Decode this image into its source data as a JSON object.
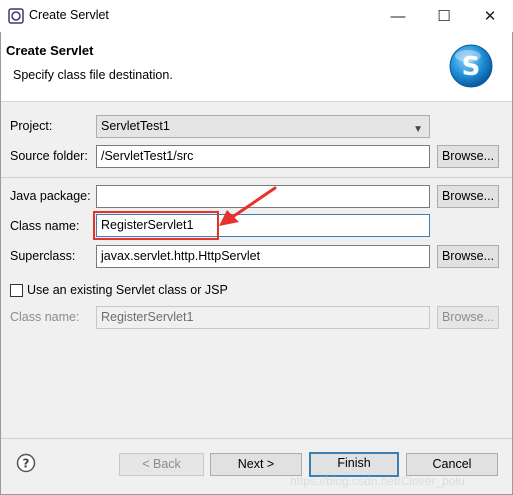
{
  "window": {
    "title": "Create Servlet",
    "controls": {
      "minimize": "—",
      "maximize": "☐",
      "close": "✕"
    }
  },
  "banner": {
    "title": "Create Servlet",
    "description": "Specify class file destination."
  },
  "form": {
    "project": {
      "label": "Project:",
      "value": "ServletTest1"
    },
    "source_folder": {
      "label": "Source folder:",
      "value": "/ServletTest1/src",
      "button": "Browse..."
    },
    "java_package": {
      "label": "Java package:",
      "value": "",
      "button": "Browse..."
    },
    "class_name": {
      "label": "Class name:",
      "value": "RegisterServlet1"
    },
    "superclass": {
      "label": "Superclass:",
      "value": "javax.servlet.http.HttpServlet",
      "button": "Browse..."
    },
    "use_existing": {
      "label": "Use an existing Servlet class or JSP",
      "checked": false
    },
    "existing_class_name": {
      "label": "Class name:",
      "value": "RegisterServlet1",
      "button": "Browse..."
    }
  },
  "footer": {
    "help": "?",
    "back": "< Back",
    "next": "Next >",
    "finish": "Finish",
    "cancel": "Cancel"
  },
  "watermark": "https://blog.csdn.net/Clover_polu",
  "colors": {
    "highlight": "#e8302c",
    "focus": "#3c7fb1",
    "logo": "#1f8fd6"
  }
}
